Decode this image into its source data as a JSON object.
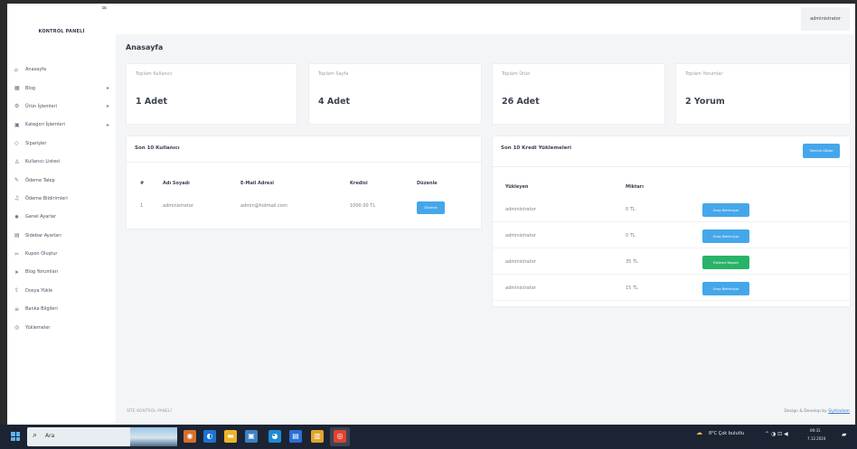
{
  "app": {
    "panel_title": "KONTROL PANELİ",
    "brand_glyph": "∞",
    "user_label": "administrator",
    "page_title": "Anasayfa"
  },
  "sidebar": {
    "items": [
      {
        "icon": "home-icon",
        "glyph": "⌂",
        "label": "Anasayfa",
        "has_arrow": false
      },
      {
        "icon": "blog-icon",
        "glyph": "▦",
        "label": "Blog",
        "has_arrow": true
      },
      {
        "icon": "product-icon",
        "glyph": "⚙",
        "label": "Ürün İşlemleri",
        "has_arrow": true
      },
      {
        "icon": "category-icon",
        "glyph": "▣",
        "label": "Kategori İşlemleri",
        "has_arrow": true
      },
      {
        "icon": "orders-icon",
        "glyph": "◇",
        "label": "Siparişler",
        "has_arrow": false
      },
      {
        "icon": "users-icon",
        "glyph": "♙",
        "label": "Kullanıcı Listesi",
        "has_arrow": false
      },
      {
        "icon": "request-icon",
        "glyph": "✎",
        "label": "Ödeme Talep",
        "has_arrow": false
      },
      {
        "icon": "notifications-icon",
        "glyph": "♫",
        "label": "Ödeme Bildirimleri",
        "has_arrow": false
      },
      {
        "icon": "settings-icon",
        "glyph": "✹",
        "label": "Genel Ayarlar",
        "has_arrow": false
      },
      {
        "icon": "sidebar-settings-icon",
        "glyph": "▤",
        "label": "Sidebar Ayarları",
        "has_arrow": false
      },
      {
        "icon": "coupon-icon",
        "glyph": "✂",
        "label": "Kupon Oluştur",
        "has_arrow": false
      },
      {
        "icon": "send-icon",
        "glyph": "➤",
        "label": "Blog Yorumları",
        "has_arrow": false
      },
      {
        "icon": "upload-icon",
        "glyph": "⇪",
        "label": "Dosya Yükle",
        "has_arrow": false
      },
      {
        "icon": "info-icon",
        "glyph": "≡",
        "label": "Banka Bilgileri",
        "has_arrow": false
      },
      {
        "icon": "downloads-icon",
        "glyph": "◎",
        "label": "Yüklemeler",
        "has_arrow": false
      }
    ]
  },
  "stats": [
    {
      "label": "Toplam Kullanıcı",
      "value": "1 Adet"
    },
    {
      "label": "Toplam Sayfa",
      "value": "4 Adet"
    },
    {
      "label": "Toplam Ürün",
      "value": "26 Adet"
    },
    {
      "label": "Toplam Yorumlar",
      "value": "2 Yorum"
    }
  ],
  "users_table": {
    "title": "Son 10 Kullanıcı",
    "headers": [
      "#",
      "Adı Soyadı",
      "E-Mail Adresi",
      "Kredisi",
      "Düzenle"
    ],
    "rows": [
      {
        "id": "1",
        "name": "administrator",
        "email": "admin@hotmail.com",
        "credit": "1000.00 TL",
        "action": "Düzenle"
      }
    ]
  },
  "credits_table": {
    "title": "Son 10 Kredi Yüklemeleri",
    "top_button": "Tümünü Göster",
    "headers": [
      "Yükleyen",
      "Miktarı"
    ],
    "rows": [
      {
        "user": "administrator",
        "amount": "0 TL",
        "status": "Onay Bekleniyor",
        "color": "#45a7ea"
      },
      {
        "user": "administrator",
        "amount": "0 TL",
        "status": "Onay Bekleniyor",
        "color": "#45a7ea"
      },
      {
        "user": "administrator",
        "amount": "35 TL",
        "status": "Yükleme Başarılı",
        "color": "#29b36a"
      },
      {
        "user": "administrator",
        "amount": "15 TL",
        "status": "Onay Bekleniyor",
        "color": "#45a7ea"
      }
    ]
  },
  "footer": {
    "left": "SİTE KONTROL PANELİ",
    "right_prefix": "Design & Develop by",
    "right_link": "Siyitiadam"
  },
  "taskbar": {
    "search_text": "Ara",
    "weather": "8°C  Çok bulutlu",
    "time": "09:31",
    "date": "7.12.2024"
  }
}
